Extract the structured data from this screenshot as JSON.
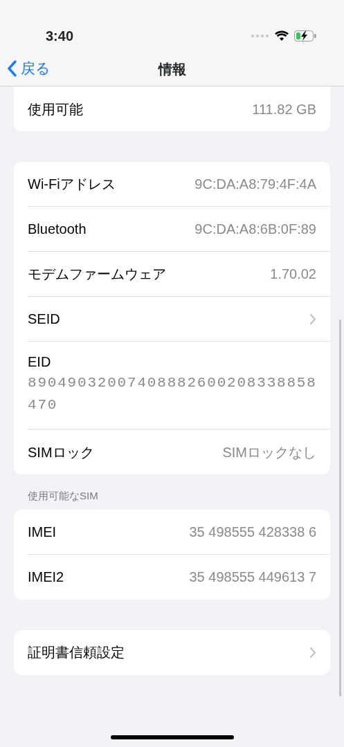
{
  "status_bar": {
    "time": "3:40"
  },
  "nav": {
    "back": "戻る",
    "title": "情報"
  },
  "groups": [
    {
      "rows": [
        {
          "kind": "value",
          "label": "使用可能",
          "value": "111.82 GB"
        }
      ]
    },
    {
      "rows": [
        {
          "kind": "value",
          "label": "Wi-Fiアドレス",
          "value": "9C:DA:A8:79:4F:4A"
        },
        {
          "kind": "value",
          "label": "Bluetooth",
          "value": "9C:DA:A8:6B:0F:89"
        },
        {
          "kind": "value",
          "label": "モデムファームウェア",
          "value": "1.70.02"
        },
        {
          "kind": "chevron",
          "label": "SEID"
        },
        {
          "kind": "stacked",
          "label": "EID",
          "value": "89049032007408882600208338858470"
        },
        {
          "kind": "value",
          "label": "SIMロック",
          "value": "SIMロックなし"
        }
      ]
    },
    {
      "header": "使用可能なSIM",
      "rows": [
        {
          "kind": "value",
          "label": "IMEI",
          "value": "35 498555 428338 6"
        },
        {
          "kind": "value",
          "label": "IMEI2",
          "value": "35 498555 449613 7"
        }
      ]
    },
    {
      "rows": [
        {
          "kind": "chevron",
          "label": "証明書信頼設定"
        }
      ]
    }
  ]
}
